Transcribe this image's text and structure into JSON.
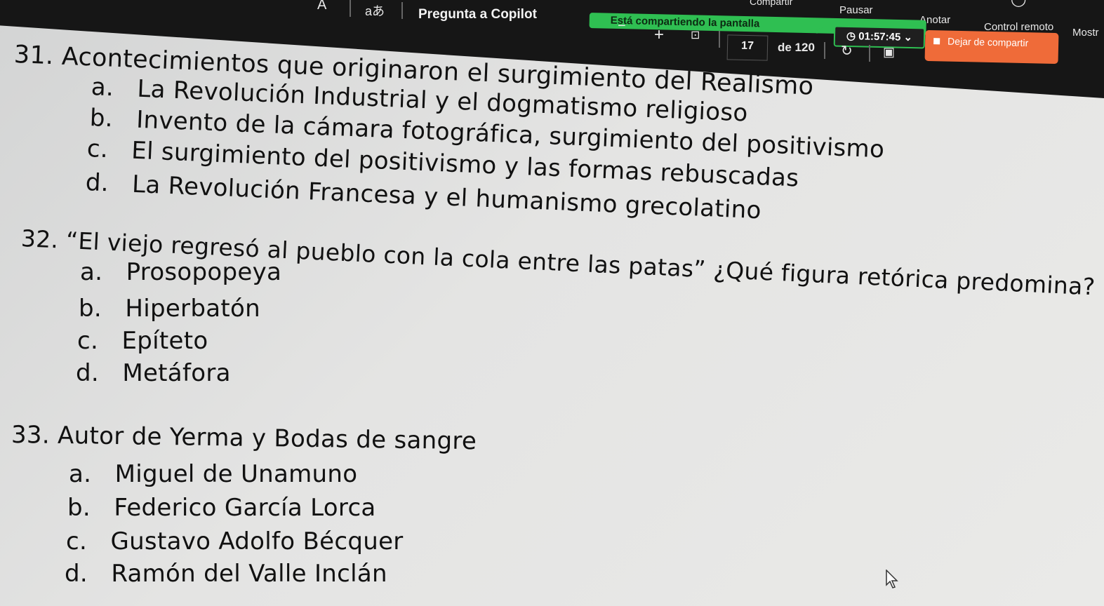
{
  "toolbar": {
    "font_size_control": "A",
    "reader_icon": "aあ",
    "copilot_label": "Pregunta a Copilot",
    "sharing_status": "Está compartiendo la pantalla",
    "timer": "01:57:45",
    "share_label": "Compartir",
    "pause_label": "Pausar",
    "annotate_label": "Anotar",
    "remote_control_label": "Control remoto",
    "more_label": "Mostr",
    "stop_sharing_label": "Dejar de compartir",
    "zoom_out": "−",
    "zoom_in": "+",
    "page_current": "17",
    "page_total": "de 120"
  },
  "questions": [
    {
      "number": "31.",
      "text": "Acontecimientos que originaron el surgimiento del Realismo",
      "options": [
        {
          "letter": "a.",
          "text": "La Revolución Industrial y el dogmatismo religioso"
        },
        {
          "letter": "b.",
          "text": "Invento de la cámara fotográfica, surgimiento del positivismo"
        },
        {
          "letter": "c.",
          "text": "El surgimiento del positivismo y las formas rebuscadas"
        },
        {
          "letter": "d.",
          "text": "La Revolución Francesa y el humanismo grecolatino"
        }
      ]
    },
    {
      "number": "32.",
      "text": "“El viejo regresó al pueblo con la cola entre las patas” ¿Qué figura retórica predomina?",
      "options": [
        {
          "letter": "a.",
          "text": "Prosopopeya"
        },
        {
          "letter": "b.",
          "text": "Hiperbatón"
        },
        {
          "letter": "c.",
          "text": "Epíteto"
        },
        {
          "letter": "d.",
          "text": "Metáfora"
        }
      ]
    },
    {
      "number": "33.",
      "text": "Autor de  Yerma y Bodas de sangre",
      "options": [
        {
          "letter": "a.",
          "text": "Miguel de Unamuno"
        },
        {
          "letter": "b.",
          "text": "Federico García Lorca"
        },
        {
          "letter": "c.",
          "text": "Gustavo Adolfo Bécquer"
        },
        {
          "letter": "d.",
          "text": "Ramón del Valle Inclán"
        }
      ]
    }
  ],
  "colors": {
    "toolbar_bg": "#161616",
    "sharing_green": "#2fbf52",
    "stop_orange": "#ef6b39",
    "paper": "#e4e4e3"
  }
}
